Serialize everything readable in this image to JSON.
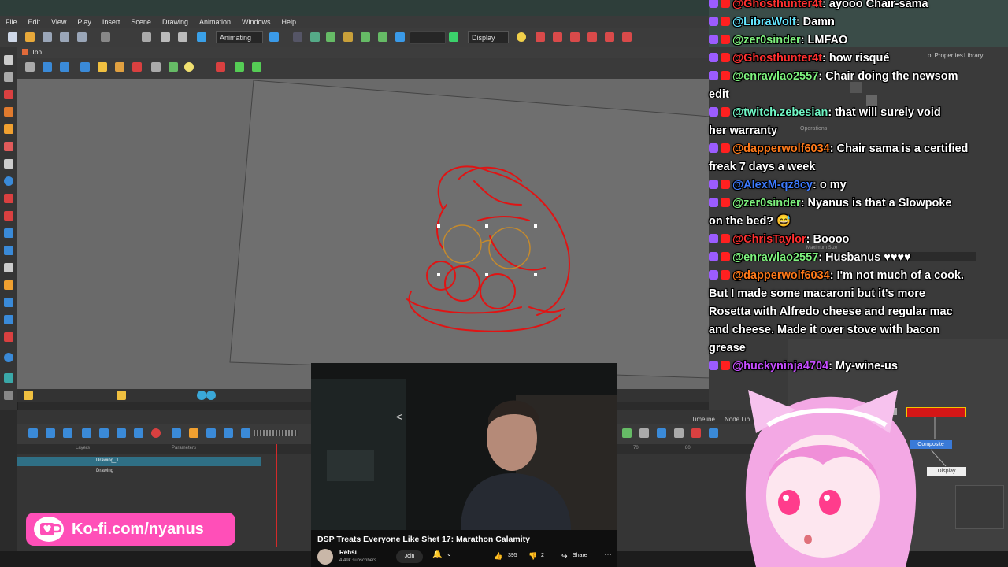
{
  "menu": [
    "File",
    "Edit",
    "View",
    "Play",
    "Insert",
    "Scene",
    "Drawing",
    "Animation",
    "Windows",
    "Help"
  ],
  "toolbar": {
    "mode": "Animating",
    "display": "Display"
  },
  "view_tab": "Top",
  "right_tabs": {
    "tool_properties": "ol Properties",
    "library": "Library",
    "operations": "Operations",
    "max_size": "Maximum Size"
  },
  "bottom_tabs": {
    "timeline": "Timeline",
    "node_library": "Node Lib"
  },
  "layers": {
    "header_layers": "Layers",
    "header_params": "Parameters",
    "rows": [
      "Drawing_1",
      "Drawing"
    ]
  },
  "timeline_numbers": [
    "70",
    "80"
  ],
  "nodes": {
    "composite": "Composite",
    "display": "Display"
  },
  "chat": [
    {
      "user": "@Ghosthunter4t",
      "color": "#ff3030",
      "text": ": ayooo Chair-sama"
    },
    {
      "user": "@LibraWolf",
      "color": "#63e6ff",
      "text": ": Damn"
    },
    {
      "user": "@zer0sinder",
      "color": "#7ef37e",
      "text": ": LMFAO"
    },
    {
      "user": "@Ghosthunter4t",
      "color": "#ff3030",
      "text": ": how risqué"
    },
    {
      "user": "@enrawlao2557",
      "color": "#7ef37e",
      "text": ": Chair doing the newsom"
    },
    {
      "user": "",
      "color": "#ffffff",
      "text": "edit"
    },
    {
      "user": "@twitch.zebesian",
      "color": "#6ff5c4",
      "text": ": that will surely void"
    },
    {
      "user": "",
      "color": "#ffffff",
      "text": "her warranty"
    },
    {
      "user": "@dapperwolf6034",
      "color": "#ff7a1a",
      "text": ": Chair sama is a certified"
    },
    {
      "user": "",
      "color": "#ffffff",
      "text": "freak 7 days a week"
    },
    {
      "user": "@AlexM-qz8cy",
      "color": "#3d7bff",
      "text": ": o my"
    },
    {
      "user": "@zer0sinder",
      "color": "#7ef37e",
      "text": ": Nyanus is that a Slowpoke"
    },
    {
      "user": "",
      "color": "#ffffff",
      "text": "on the bed? 😅"
    },
    {
      "user": "@ChrisTaylor",
      "color": "#ff3030",
      "text": ": Boooo"
    },
    {
      "user": "@enrawlao2557",
      "color": "#7ef37e",
      "text": ": Husbanus ♥♥♥♥"
    },
    {
      "user": "@dapperwolf6034",
      "color": "#ff7a1a",
      "text": ": I'm not much of a cook."
    },
    {
      "user": "",
      "color": "#ffffff",
      "text": "But I made some macaroni but it's more"
    },
    {
      "user": "",
      "color": "#ffffff",
      "text": "Rosetta with Alfredo cheese and regular mac"
    },
    {
      "user": "",
      "color": "#ffffff",
      "text": "and cheese. Made it over stove with bacon"
    },
    {
      "user": "",
      "color": "#ffffff",
      "text": "grease"
    },
    {
      "user": "@huckyninja4704",
      "color": "#c64dff",
      "text": ": My-wine-us"
    }
  ],
  "youtube": {
    "title": "DSP Treats Everyone Like Shet 17: Marathon Calamity",
    "channel": "Rebsi",
    "subscribers": "4.49k subscribers",
    "join": "Join",
    "likes": "395",
    "dislikes": "2",
    "share": "Share"
  },
  "kofi": {
    "text": "Ko-fi.com/nyanus"
  }
}
